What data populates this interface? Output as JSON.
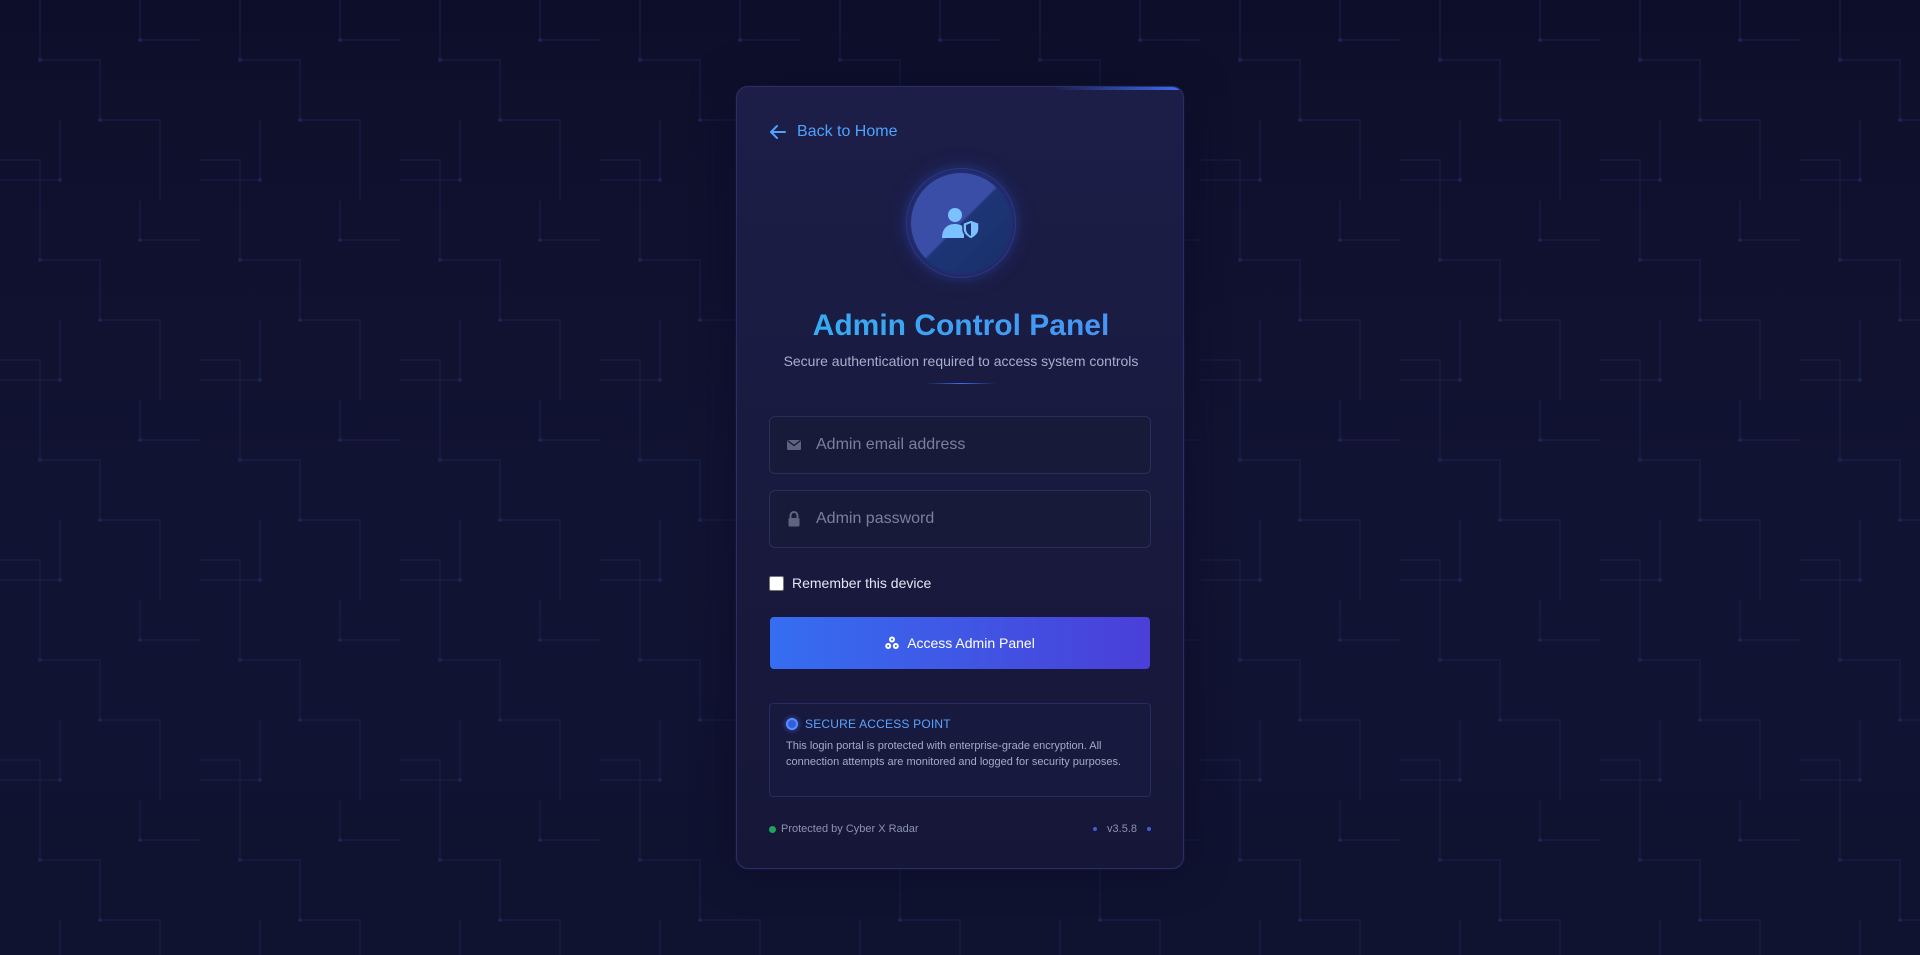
{
  "nav": {
    "back_label": "Back to Home",
    "back_icon": "arrow-left-icon"
  },
  "header": {
    "logo_icon": "admin-shield-user-icon",
    "title": "Admin Control Panel",
    "subtitle": "Secure authentication required to access system controls"
  },
  "form": {
    "email": {
      "placeholder": "Admin email address",
      "value": "",
      "icon": "envelope-icon"
    },
    "password": {
      "placeholder": "Admin password",
      "value": "",
      "icon": "lock-icon"
    },
    "remember": {
      "label": "Remember this device",
      "checked": false
    },
    "submit": {
      "label": "Access Admin Panel",
      "icon": "users-cog-icon"
    }
  },
  "notice": {
    "title": "SECURE ACCESS POINT",
    "text": "This login portal is protected with enterprise-grade encryption. All connection attempts are monitored and logged for security purposes."
  },
  "footer": {
    "protected_by": "Protected by Cyber X Radar",
    "version": "v3.5.8"
  },
  "colors": {
    "accent": "#4ea3ff",
    "button_start": "#356ef2",
    "button_end": "#4a3fd8",
    "status_online": "#1fa35e",
    "background": "#0d0f2a"
  }
}
